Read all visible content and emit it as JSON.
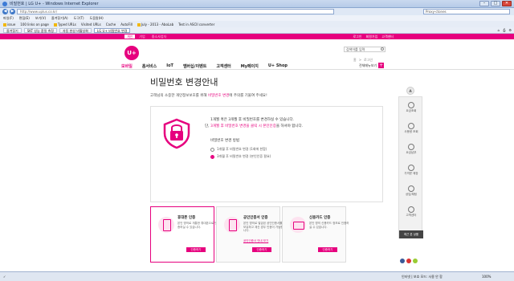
{
  "browser": {
    "title": "비밀번호 | LG U+ - Windows Internet Explorer",
    "url": "http://www.uplus.co.kr/",
    "search_value": "Proxy-ctones",
    "menu": [
      "파일(F)",
      "편집(E)",
      "보기(V)",
      "즐겨찾기(A)",
      "도구(T)",
      "도움말(H)"
    ],
    "links": [
      "issue",
      "100 links on page",
      "Typed URLs",
      "Visited URLs",
      "Cache",
      "AutoFill",
      "July - 2013 - AboLab",
      "Test in ASCII converter"
    ],
    "tabs": [
      "즐겨찾기",
      "SKT 성능 품질 측정",
      "자동 완성 비활성화",
      "LG U+ 비밀번호 변경"
    ],
    "status_zone": "인터넷 | 보호 모드: 사용 안 함",
    "zoom": "100%"
  },
  "site": {
    "util_tabs": [
      "개인",
      "기업",
      "중소사업자"
    ],
    "top_links": [
      "로그인",
      "회원가입",
      "고객센터"
    ],
    "logo": "U+",
    "search_placeholder": "검색어를 입력",
    "nav": [
      "모바일",
      "홈서비스",
      "IoT",
      "멤버십/이벤트",
      "고객센터",
      "My페이지",
      "U+ Shop"
    ],
    "full_menu": "전체메뉴보기",
    "breadcrumb": [
      "홈",
      ">",
      "로그인"
    ]
  },
  "page": {
    "title": "비밀번호 변경안내",
    "subtitle_pre": "고객님의 소중한 개인정보보호를 위해 ",
    "subtitle_em": "비밀번호 변경",
    "subtitle_post": "에 주의를 기울여 주세요!",
    "info_line1": "1개월 혹은 3개월 후 비밀번호를 변경하실 수 있습니다.",
    "info_line2_pre": "단, ",
    "info_line2_em": "3개월 후 비밀번호 변경을 클릭 시 본인인증",
    "info_line2_post": "을 하셔야 합니다.",
    "option_title": "비밀번호 변경 방법",
    "options": [
      "1개월 후 비밀번호 변경 (1회에 한함)",
      "3개월 후 비밀번호 변경 (본인인증 필요)"
    ],
    "selected_option": 1
  },
  "cards": [
    {
      "title": "휴대폰 인증",
      "desc": "본인 명의로 개통한 휴대폰으로 인증하실 수 있습니다.",
      "link": "",
      "button": "인증하기"
    },
    {
      "title": "공인인증서 인증",
      "desc": "본인 명의로 발급된 공인인증서를 보유하고 계신 경우 인증이 가능합니다.",
      "link": "공인인증서 안내 보기",
      "button": "인증하기"
    },
    {
      "title": "신용카드 인증",
      "desc": "본인 명의 신용카드 정보로 인증하실 수 있습니다.",
      "link": "",
      "button": "인증하기"
    }
  ],
  "quick_menu": {
    "top": "▲",
    "items": [
      "요금조회",
      "사용량 조회",
      "요금납부",
      "가까운 매장",
      "상담/채팅",
      "고객센터"
    ],
    "footer": "최근 본 상품"
  },
  "colors": {
    "brand": "#e6007e",
    "chrome": "#dfe8f5"
  }
}
